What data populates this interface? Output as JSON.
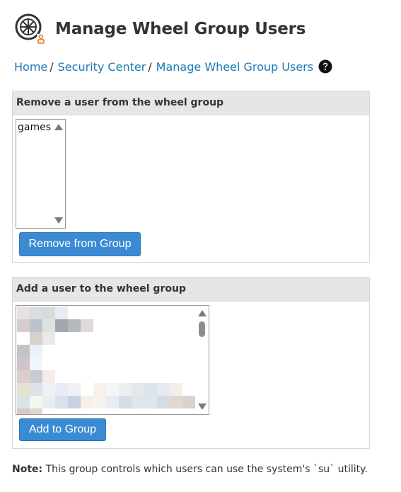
{
  "header": {
    "title": "Manage Wheel Group Users",
    "icon": "wheel-icon"
  },
  "breadcrumb": {
    "items": [
      {
        "label": "Home",
        "sep": "/"
      },
      {
        "label": "Security Center",
        "sep": "/"
      },
      {
        "label": "Manage Wheel Group Users",
        "sep": ""
      }
    ],
    "help_icon": "question-circle-icon"
  },
  "remove_panel": {
    "heading": "Remove a user from the wheel group",
    "users": [
      "games"
    ],
    "button_label": "Remove from Group"
  },
  "add_panel": {
    "heading": "Add a user to the wheel group",
    "users_redacted": true,
    "button_label": "Add to Group"
  },
  "note": {
    "label": "Note:",
    "text": " This group controls which users can use the system's `su` utility."
  },
  "colors": {
    "link": "#1a7ab8",
    "button": "#3b8bd4",
    "panel_heading_bg": "#e6e6e6",
    "text": "#333333"
  }
}
